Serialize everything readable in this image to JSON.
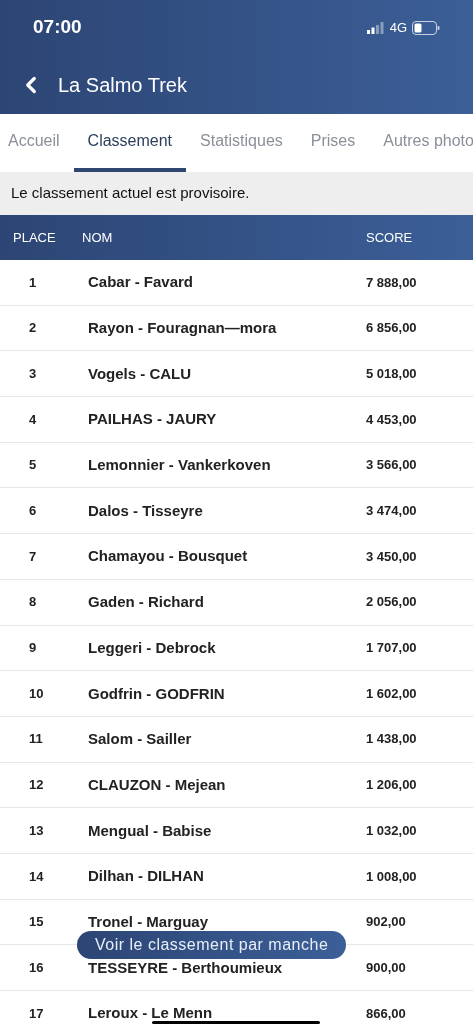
{
  "status_bar": {
    "time": "07:00",
    "network": "4G"
  },
  "header": {
    "title": "La Salmo Trek"
  },
  "tabs": [
    {
      "label": "Accueil",
      "selected": false
    },
    {
      "label": "Classement",
      "selected": true
    },
    {
      "label": "Statistiques",
      "selected": false
    },
    {
      "label": "Prises",
      "selected": false
    },
    {
      "label": "Autres photo",
      "selected": false
    }
  ],
  "notice": "Le classement actuel est provisoire.",
  "table": {
    "columns": [
      "PLACE",
      "NOM",
      "SCORE"
    ],
    "rows": [
      [
        "1",
        "Cabar - Favard",
        "7 888,00"
      ],
      [
        "2",
        "Rayon - Fouragnan—mora",
        "6 856,00"
      ],
      [
        "3",
        "Vogels - CALU",
        "5 018,00"
      ],
      [
        "4",
        "PAILHAS - JAURY",
        "4 453,00"
      ],
      [
        "5",
        "Lemonnier - Vankerkoven",
        "3 566,00"
      ],
      [
        "6",
        "Dalos - Tisseyre",
        "3 474,00"
      ],
      [
        "7",
        "Chamayou - Bousquet",
        "3 450,00"
      ],
      [
        "8",
        "Gaden - Richard",
        "2 056,00"
      ],
      [
        "9",
        "Leggeri - Debrock",
        "1 707,00"
      ],
      [
        "10",
        "Godfrin - GODFRIN",
        "1 602,00"
      ],
      [
        "11",
        "Salom - Sailler",
        "1 438,00"
      ],
      [
        "12",
        "CLAUZON - Mejean",
        "1 206,00"
      ],
      [
        "13",
        "Mengual - Babise",
        "1 032,00"
      ],
      [
        "14",
        "Dilhan - DILHAN",
        "1 008,00"
      ],
      [
        "15",
        "Tronel - Marguay",
        "902,00"
      ],
      [
        "16",
        "TESSEYRE - Berthoumieux",
        "900,00"
      ],
      [
        "17",
        "Leroux - Le Menn",
        "866,00"
      ]
    ]
  },
  "floating_button": "Voir le classement par manche"
}
